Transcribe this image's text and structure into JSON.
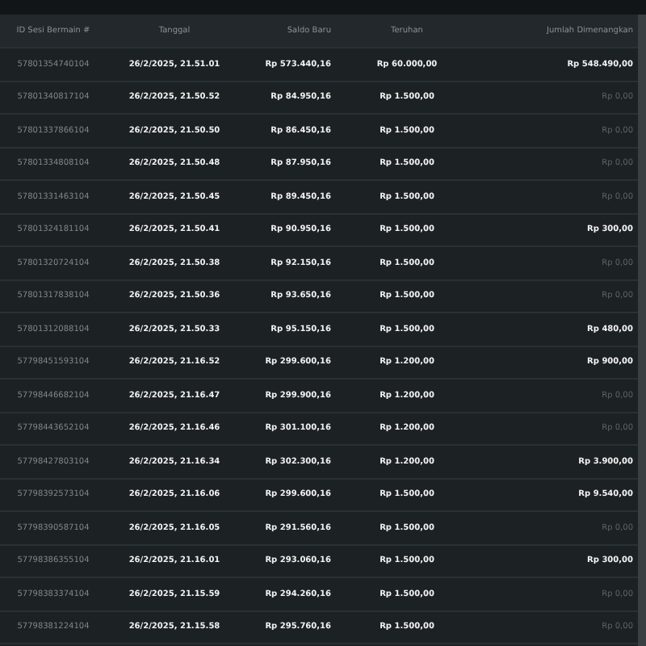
{
  "table": {
    "columns": [
      "ID Sesi Bermain #",
      "Tanggal",
      "Saldo Baru",
      "Teruhan",
      "Jumlah Dimenangkan"
    ],
    "rows": [
      {
        "id": "57801354740104",
        "date": "26/2/2025, 21.51.01",
        "balance": "Rp 573.440,16",
        "bet": "Rp 60.000,00",
        "win": "Rp 548.490,00",
        "muted": false
      },
      {
        "id": "57801340817104",
        "date": "26/2/2025, 21.50.52",
        "balance": "Rp 84.950,16",
        "bet": "Rp 1.500,00",
        "win": "Rp 0,00",
        "muted": true
      },
      {
        "id": "57801337866104",
        "date": "26/2/2025, 21.50.50",
        "balance": "Rp 86.450,16",
        "bet": "Rp 1.500,00",
        "win": "Rp 0,00",
        "muted": true
      },
      {
        "id": "57801334808104",
        "date": "26/2/2025, 21.50.48",
        "balance": "Rp 87.950,16",
        "bet": "Rp 1.500,00",
        "win": "Rp 0,00",
        "muted": true
      },
      {
        "id": "57801331463104",
        "date": "26/2/2025, 21.50.45",
        "balance": "Rp 89.450,16",
        "bet": "Rp 1.500,00",
        "win": "Rp 0,00",
        "muted": true
      },
      {
        "id": "57801324181104",
        "date": "26/2/2025, 21.50.41",
        "balance": "Rp 90.950,16",
        "bet": "Rp 1.500,00",
        "win": "Rp 300,00",
        "muted": false
      },
      {
        "id": "57801320724104",
        "date": "26/2/2025, 21.50.38",
        "balance": "Rp 92.150,16",
        "bet": "Rp 1.500,00",
        "win": "Rp 0,00",
        "muted": true
      },
      {
        "id": "57801317838104",
        "date": "26/2/2025, 21.50.36",
        "balance": "Rp 93.650,16",
        "bet": "Rp 1.500,00",
        "win": "Rp 0,00",
        "muted": true
      },
      {
        "id": "57801312088104",
        "date": "26/2/2025, 21.50.33",
        "balance": "Rp 95.150,16",
        "bet": "Rp 1.500,00",
        "win": "Rp 480,00",
        "muted": false
      },
      {
        "id": "57798451593104",
        "date": "26/2/2025, 21.16.52",
        "balance": "Rp 299.600,16",
        "bet": "Rp 1.200,00",
        "win": "Rp 900,00",
        "muted": false
      },
      {
        "id": "57798446682104",
        "date": "26/2/2025, 21.16.47",
        "balance": "Rp 299.900,16",
        "bet": "Rp 1.200,00",
        "win": "Rp 0,00",
        "muted": true
      },
      {
        "id": "57798443652104",
        "date": "26/2/2025, 21.16.46",
        "balance": "Rp 301.100,16",
        "bet": "Rp 1.200,00",
        "win": "Rp 0,00",
        "muted": true
      },
      {
        "id": "57798427803104",
        "date": "26/2/2025, 21.16.34",
        "balance": "Rp 302.300,16",
        "bet": "Rp 1.200,00",
        "win": "Rp 3.900,00",
        "muted": false
      },
      {
        "id": "57798392573104",
        "date": "26/2/2025, 21.16.06",
        "balance": "Rp 299.600,16",
        "bet": "Rp 1.500,00",
        "win": "Rp 9.540,00",
        "muted": false
      },
      {
        "id": "57798390587104",
        "date": "26/2/2025, 21.16.05",
        "balance": "Rp 291.560,16",
        "bet": "Rp 1.500,00",
        "win": "Rp 0,00",
        "muted": true
      },
      {
        "id": "57798386355104",
        "date": "26/2/2025, 21.16.01",
        "balance": "Rp 293.060,16",
        "bet": "Rp 1.500,00",
        "win": "Rp 300,00",
        "muted": false
      },
      {
        "id": "57798383374104",
        "date": "26/2/2025, 21.15.59",
        "balance": "Rp 294.260,16",
        "bet": "Rp 1.500,00",
        "win": "Rp 0,00",
        "muted": true
      },
      {
        "id": "57798381224104",
        "date": "26/2/2025, 21.15.58",
        "balance": "Rp 295.760,16",
        "bet": "Rp 1.500,00",
        "win": "Rp 0,00",
        "muted": true
      }
    ]
  }
}
